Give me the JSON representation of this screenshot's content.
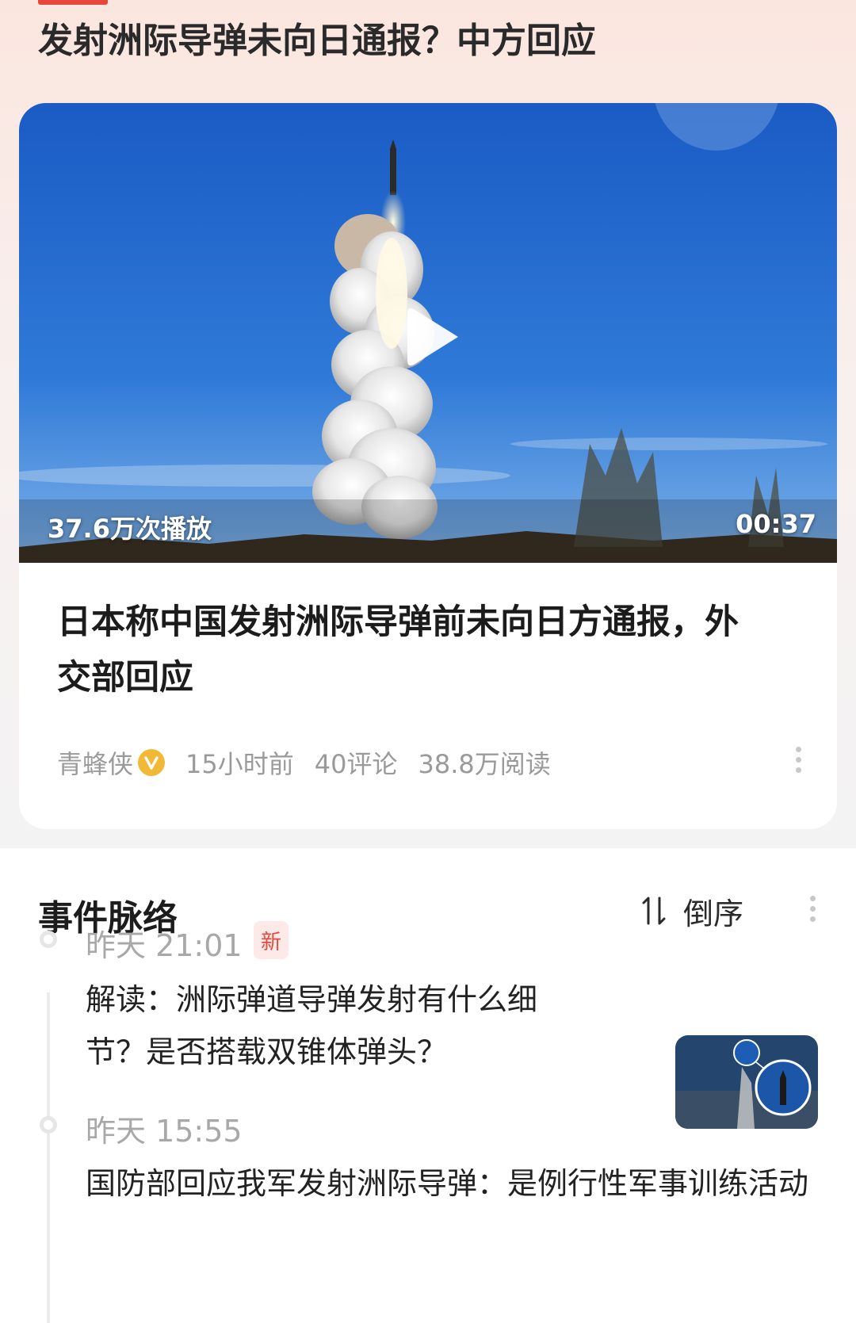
{
  "headline": "发射洲际导弹未向日通报？中方回应",
  "video": {
    "views": "37.6万次播放",
    "duration": "00:37"
  },
  "article": {
    "title": "日本称中国发射洲际导弹前未向日方通报，外交部回应",
    "author": "青蜂侠",
    "time": "15小时前",
    "comments": "40评论",
    "reads": "38.8万阅读"
  },
  "timeline": {
    "title": "事件脉络",
    "sort_label": "倒序",
    "items": [
      {
        "time": "昨天 21:01",
        "badge": "新",
        "text": "解读：洲际弹道导弹发射有什么细节？是否搭载双锥体弹头？"
      },
      {
        "time": "昨天 15:55",
        "text": "国防部回应我军发射洲际导弹：是例行性军事训练活动"
      }
    ]
  },
  "colors": {
    "accent": "#e8463a",
    "verified_badge": "#f2b938",
    "new_badge_text": "#e44a3b"
  }
}
